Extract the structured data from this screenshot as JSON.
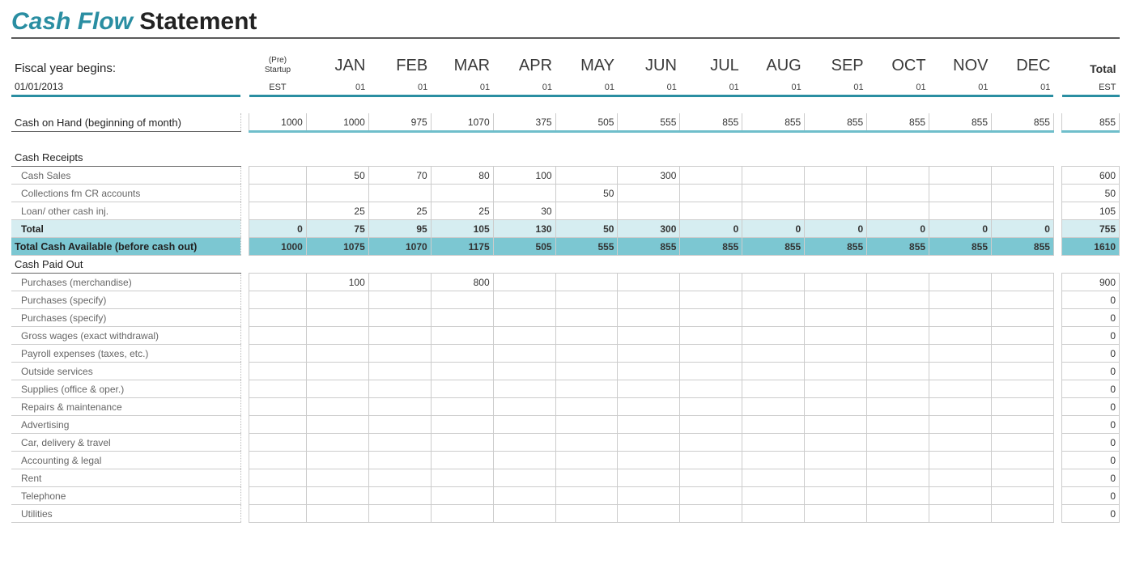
{
  "title_accent": "Cash Flow",
  "title_rest": " Statement",
  "fiscal_label": "Fiscal year begins:",
  "fiscal_date": "01/01/2013",
  "pre_label1": "(Pre)",
  "pre_label2": "Startup",
  "pre_sub": "EST",
  "months": [
    "JAN",
    "FEB",
    "MAR",
    "APR",
    "MAY",
    "JUN",
    "JUL",
    "AUG",
    "SEP",
    "OCT",
    "NOV",
    "DEC"
  ],
  "month_sub": "01",
  "total_label": "Total",
  "total_sub": "EST",
  "coh": {
    "label": "Cash on Hand (beginning of month)",
    "pre": "1000",
    "vals": [
      "1000",
      "975",
      "1070",
      "375",
      "505",
      "555",
      "855",
      "855",
      "855",
      "855",
      "855",
      "855"
    ],
    "total": "855"
  },
  "receipts": {
    "heading": "Cash Receipts",
    "rows": [
      {
        "label": "Cash Sales",
        "pre": "",
        "vals": [
          "50",
          "70",
          "80",
          "100",
          "",
          "300",
          "",
          "",
          "",
          "",
          "",
          ""
        ],
        "total": "600"
      },
      {
        "label": "Collections fm CR accounts",
        "pre": "",
        "vals": [
          "",
          "",
          "",
          "",
          "50",
          "",
          "",
          "",
          "",
          "",
          "",
          ""
        ],
        "total": "50"
      },
      {
        "label": "Loan/ other cash inj.",
        "pre": "",
        "vals": [
          "25",
          "25",
          "25",
          "30",
          "",
          "",
          "",
          "",
          "",
          "",
          "",
          ""
        ],
        "total": "105"
      }
    ],
    "subtotal": {
      "label": "Total",
      "pre": "0",
      "vals": [
        "75",
        "95",
        "105",
        "130",
        "50",
        "300",
        "0",
        "0",
        "0",
        "0",
        "0",
        "0"
      ],
      "total": "755"
    },
    "grand": {
      "label": "Total Cash Available (before cash out)",
      "pre": "1000",
      "vals": [
        "1075",
        "1070",
        "1175",
        "505",
        "555",
        "855",
        "855",
        "855",
        "855",
        "855",
        "855",
        "855"
      ],
      "total": "1610"
    }
  },
  "paidout": {
    "heading": "Cash Paid Out",
    "rows": [
      {
        "label": "Purchases (merchandise)",
        "pre": "",
        "vals": [
          "100",
          "",
          "800",
          "",
          "",
          "",
          "",
          "",
          "",
          "",
          "",
          ""
        ],
        "total": "900"
      },
      {
        "label": "Purchases (specify)",
        "pre": "",
        "vals": [
          "",
          "",
          "",
          "",
          "",
          "",
          "",
          "",
          "",
          "",
          "",
          ""
        ],
        "total": "0"
      },
      {
        "label": "Purchases (specify)",
        "pre": "",
        "vals": [
          "",
          "",
          "",
          "",
          "",
          "",
          "",
          "",
          "",
          "",
          "",
          ""
        ],
        "total": "0"
      },
      {
        "label": "Gross wages (exact withdrawal)",
        "pre": "",
        "vals": [
          "",
          "",
          "",
          "",
          "",
          "",
          "",
          "",
          "",
          "",
          "",
          ""
        ],
        "total": "0"
      },
      {
        "label": "Payroll expenses (taxes, etc.)",
        "pre": "",
        "vals": [
          "",
          "",
          "",
          "",
          "",
          "",
          "",
          "",
          "",
          "",
          "",
          ""
        ],
        "total": "0"
      },
      {
        "label": "Outside services",
        "pre": "",
        "vals": [
          "",
          "",
          "",
          "",
          "",
          "",
          "",
          "",
          "",
          "",
          "",
          ""
        ],
        "total": "0"
      },
      {
        "label": "Supplies (office & oper.)",
        "pre": "",
        "vals": [
          "",
          "",
          "",
          "",
          "",
          "",
          "",
          "",
          "",
          "",
          "",
          ""
        ],
        "total": "0"
      },
      {
        "label": "Repairs & maintenance",
        "pre": "",
        "vals": [
          "",
          "",
          "",
          "",
          "",
          "",
          "",
          "",
          "",
          "",
          "",
          ""
        ],
        "total": "0"
      },
      {
        "label": "Advertising",
        "pre": "",
        "vals": [
          "",
          "",
          "",
          "",
          "",
          "",
          "",
          "",
          "",
          "",
          "",
          ""
        ],
        "total": "0"
      },
      {
        "label": "Car, delivery & travel",
        "pre": "",
        "vals": [
          "",
          "",
          "",
          "",
          "",
          "",
          "",
          "",
          "",
          "",
          "",
          ""
        ],
        "total": "0"
      },
      {
        "label": "Accounting & legal",
        "pre": "",
        "vals": [
          "",
          "",
          "",
          "",
          "",
          "",
          "",
          "",
          "",
          "",
          "",
          ""
        ],
        "total": "0"
      },
      {
        "label": "Rent",
        "pre": "",
        "vals": [
          "",
          "",
          "",
          "",
          "",
          "",
          "",
          "",
          "",
          "",
          "",
          ""
        ],
        "total": "0"
      },
      {
        "label": "Telephone",
        "pre": "",
        "vals": [
          "",
          "",
          "",
          "",
          "",
          "",
          "",
          "",
          "",
          "",
          "",
          ""
        ],
        "total": "0"
      },
      {
        "label": "Utilities",
        "pre": "",
        "vals": [
          "",
          "",
          "",
          "",
          "",
          "",
          "",
          "",
          "",
          "",
          "",
          ""
        ],
        "total": "0"
      }
    ]
  }
}
